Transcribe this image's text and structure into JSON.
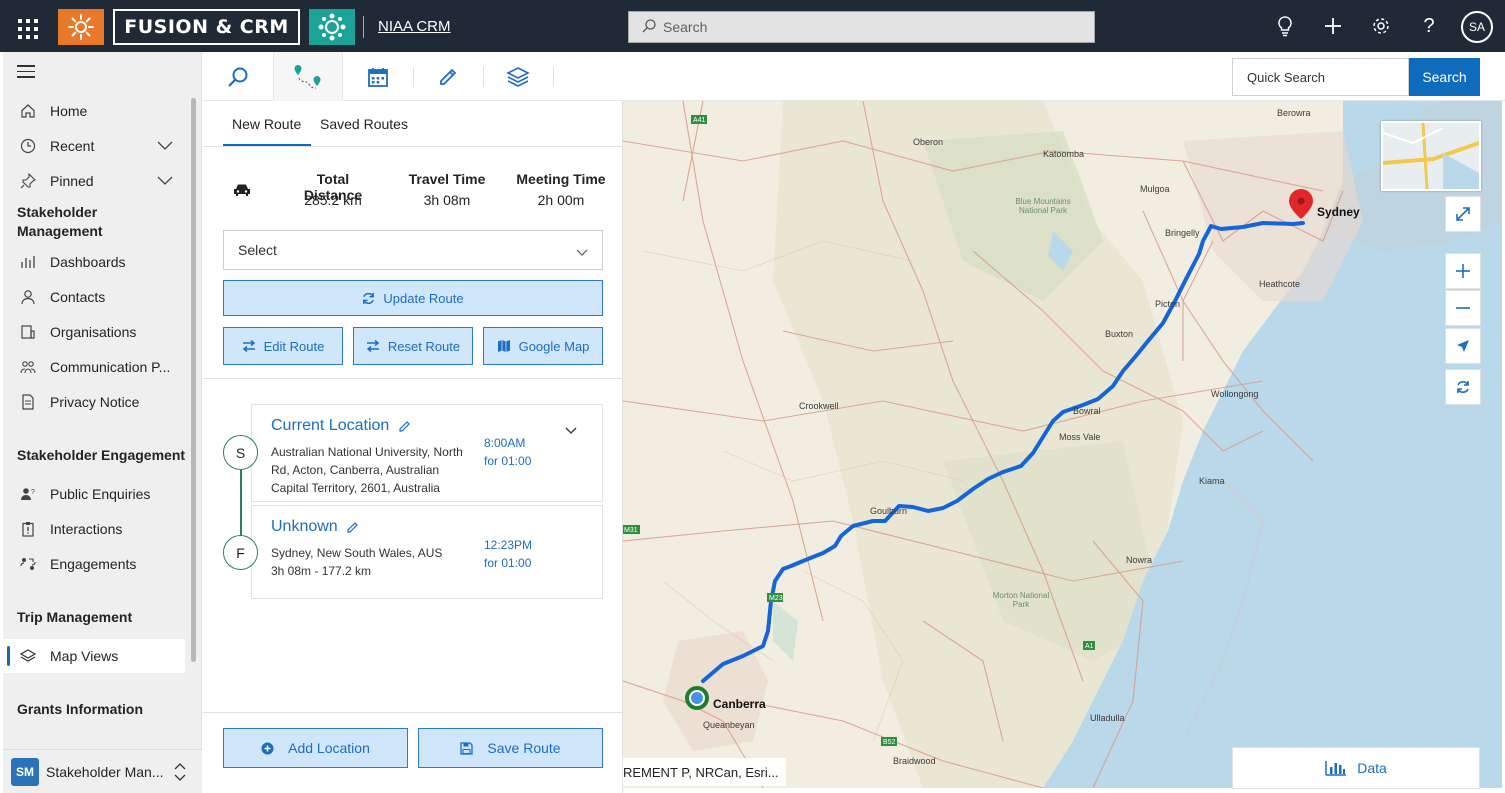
{
  "topbar": {
    "brand": "FUSION & CRM",
    "app_name": "NIAA CRM",
    "search_placeholder": "Search",
    "avatar_initials": "SA",
    "icons": [
      "waffle-icon",
      "lightbulb-icon",
      "plus-icon",
      "gear-icon",
      "help-icon"
    ]
  },
  "nav": {
    "items_top": [
      {
        "label": "Home",
        "icon": "home-icon"
      },
      {
        "label": "Recent",
        "icon": "clock-icon"
      },
      {
        "label": "Pinned",
        "icon": "pin-icon"
      }
    ],
    "group_stakeholder_mgmt": "Stakeholder Management",
    "items_mgmt": [
      {
        "label": "Dashboards",
        "icon": "dashboard-icon"
      },
      {
        "label": "Contacts",
        "icon": "person-icon"
      },
      {
        "label": "Organisations",
        "icon": "building-icon"
      },
      {
        "label": "Communication P...",
        "icon": "people-icon"
      },
      {
        "label": "Privacy Notice",
        "icon": "document-icon"
      }
    ],
    "group_engagement": "Stakeholder Engagement",
    "items_engagement": [
      {
        "label": "Public Enquiries",
        "icon": "enquiry-icon"
      },
      {
        "label": "Interactions",
        "icon": "clipboard-icon"
      },
      {
        "label": "Engagements",
        "icon": "engagement-icon"
      }
    ],
    "group_trip": "Trip Management",
    "items_trip": [
      {
        "label": "Map Views",
        "icon": "layers-icon"
      }
    ],
    "group_grants": "Grants Information",
    "area_badge": "SM",
    "area_label": "Stakeholder Man..."
  },
  "toolbar": {
    "tabs": [
      "search-tab-icon",
      "route-tab-icon",
      "calendar-tab-icon",
      "pencil-tab-icon",
      "layers-tab-icon"
    ],
    "quick_search_placeholder": "Quick Search",
    "search_button": "Search"
  },
  "route_panel": {
    "tab_new": "New Route",
    "tab_saved": "Saved Routes",
    "stats": {
      "distance_label": "Total Distance",
      "distance_value": "285.2 km",
      "travel_label": "Travel Time",
      "travel_value": "3h 08m",
      "meeting_label": "Meeting Time",
      "meeting_value": "2h 00m"
    },
    "select_placeholder": "Select",
    "update_route": "Update Route",
    "edit_route": "Edit Route",
    "reset_route": "Reset Route",
    "google_map": "Google Map",
    "stops": [
      {
        "marker": "S",
        "title": "Current Location",
        "address_lines": [
          "Australian National University, North",
          "Rd, Acton, Canberra, Australian",
          "Capital Territory, 2601, Australia"
        ],
        "time": "8:00AM",
        "duration": "for 01:00"
      },
      {
        "marker": "F",
        "title": "Unknown",
        "address_lines": [
          "Sydney, New South Wales, AUS",
          "3h 08m - 177.2 km"
        ],
        "time": "12:23PM",
        "duration": "for 01:00"
      }
    ],
    "add_location": "Add Location",
    "save_route": "Save Route"
  },
  "map": {
    "attribution": "REMENT P, NRCan, Esri...",
    "data_button": "Data",
    "places": [
      "Berowra",
      "Oberon",
      "Katoomba",
      "Mulgoa",
      "Sydney",
      "Bringelly",
      "Heathcote",
      "Picton",
      "Buxton",
      "Wollongong",
      "Crookwell",
      "Bowral",
      "Moss Vale",
      "Kiama",
      "Goulburn",
      "Nowra",
      "Canberra",
      "Queanbeyan",
      "Ulladulla",
      "Braidwood"
    ],
    "parks": [
      "Blue Mountains National Park",
      "Morton National Park"
    ],
    "road_shields": [
      "A41",
      "M31",
      "M23",
      "A1",
      "A1",
      "B52"
    ],
    "colors": {
      "route": "#1565d8",
      "water": "#b9d8ea",
      "land": "#f1eee1"
    }
  }
}
